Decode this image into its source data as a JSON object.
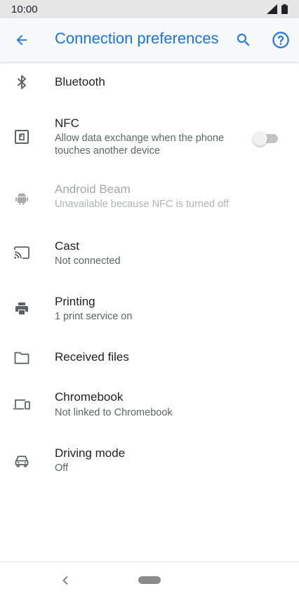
{
  "status_bar": {
    "time": "10:00"
  },
  "app_bar": {
    "title": "Connection preferences"
  },
  "items": [
    {
      "label": "Bluetooth",
      "icon": "bluetooth-icon"
    },
    {
      "label": "NFC",
      "subtitle": "Allow data exchange when the phone touches another device",
      "icon": "nfc-icon",
      "toggle_on": false
    },
    {
      "label": "Android Beam",
      "subtitle": "Unavailable because NFC is turned off",
      "icon": "android-icon",
      "disabled": true
    },
    {
      "label": "Cast",
      "subtitle": "Not connected",
      "icon": "cast-icon"
    },
    {
      "label": "Printing",
      "subtitle": "1 print service on",
      "icon": "printer-icon"
    },
    {
      "label": "Received files",
      "icon": "folder-icon"
    },
    {
      "label": "Chromebook",
      "subtitle": "Not linked to Chromebook",
      "icon": "devices-icon"
    },
    {
      "label": "Driving mode",
      "subtitle": "Off",
      "icon": "car-icon"
    }
  ],
  "colors": {
    "accent": "#1a73e8",
    "icon": "#5f6368",
    "text": "#202124",
    "secondary": "#5f6368",
    "disabled": "#a4a6a8"
  }
}
